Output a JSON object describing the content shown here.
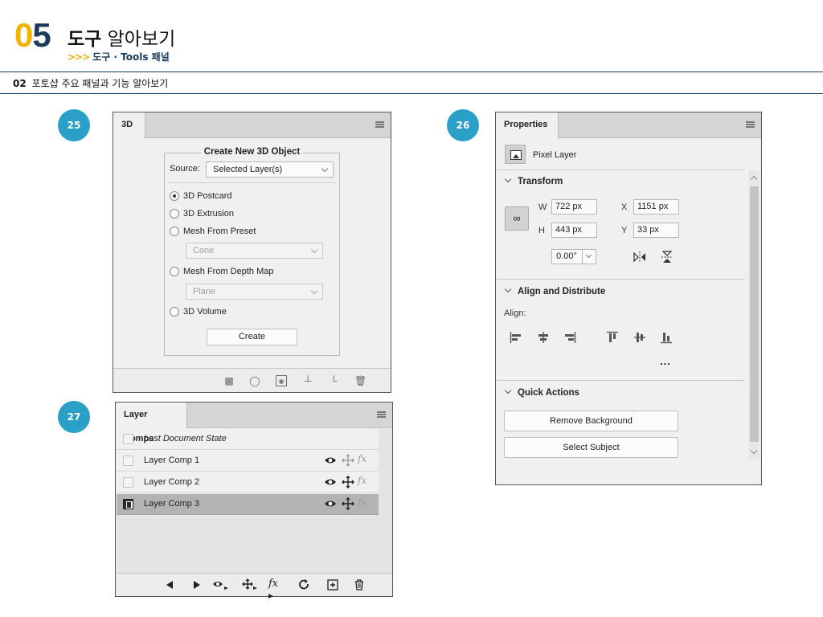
{
  "header": {
    "num_first": "0",
    "num_second": "5",
    "title_main": "도구",
    "title_rest": " 알아보기",
    "subtitle_arrows": ">>>",
    "subtitle": "도구 · Tools 패널",
    "section_num": "02",
    "section_title": "포토샵 주요 패널과 기능 알아보기"
  },
  "badges": {
    "b25": "25",
    "b26": "26",
    "b27": "27"
  },
  "panel_3d": {
    "tab": "3D",
    "group_title": "Create New 3D Object",
    "source_label": "Source:",
    "source_value": "Selected Layer(s)",
    "options": {
      "postcard": "3D Postcard",
      "extrusion": "3D Extrusion",
      "mesh_preset": "Mesh From Preset",
      "preset_value": "Cone",
      "mesh_depth": "Mesh From Depth Map",
      "depth_value": "Plane",
      "volume": "3D Volume"
    },
    "selected_option": "3D Postcard",
    "create_button": "Create",
    "footer_icons": [
      "database-icon",
      "light-bulb-icon",
      "material-icon",
      "ground-icon",
      "camera-icon",
      "trash-icon"
    ]
  },
  "panel_properties": {
    "tab": "Properties",
    "layer_type": "Pixel Layer",
    "transform": {
      "title": "Transform",
      "w_label": "W",
      "w_value": "722 px",
      "x_label": "X",
      "x_value": "1151 px",
      "h_label": "H",
      "h_value": "443 px",
      "y_label": "Y",
      "y_value": "33 px",
      "angle_value": "0.00°"
    },
    "align": {
      "title": "Align and Distribute",
      "label": "Align:",
      "more": "..."
    },
    "quick_actions": {
      "title": "Quick Actions",
      "remove_bg": "Remove Background",
      "select_subject": "Select Subject"
    }
  },
  "panel_layer_comps": {
    "tab": "Layer Comps",
    "rows": [
      {
        "label": "Last Document State",
        "italic": true
      },
      {
        "label": "Layer Comp 1"
      },
      {
        "label": "Layer Comp 2"
      },
      {
        "label": "Layer Comp 3",
        "selected": true
      }
    ],
    "fx_label": "fx"
  },
  "colors": {
    "accent_yellow": "#f2b300",
    "navy": "#1b3b5c",
    "badge_blue": "#2aa0c9"
  }
}
